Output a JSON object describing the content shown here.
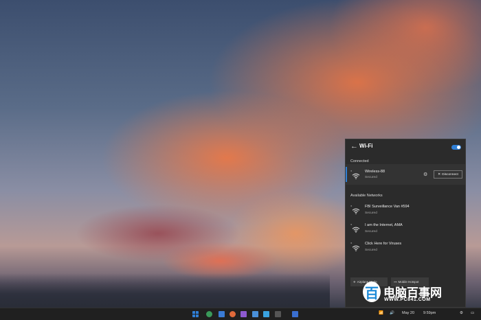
{
  "wifi_panel": {
    "title": "Wi-Fi",
    "back_icon": "←",
    "toggle_on": true,
    "connected_label": "Connected",
    "connected_network": {
      "name": "Wireless-88",
      "status": "Secured",
      "disconnect_label": "Disconnect"
    },
    "available_label": "Available Networks",
    "networks": [
      {
        "name": "FBI Surveillance Van #594",
        "status": "Secured"
      },
      {
        "name": "I am the Internet, AMA",
        "status": "Secured"
      },
      {
        "name": "Click Here for Viruses",
        "status": "Secured"
      }
    ],
    "bottom_buttons": [
      {
        "label": "Airplane Mode",
        "icon": "airplane-icon"
      },
      {
        "label": "Mobile Hotspot",
        "icon": "hotspot-icon"
      }
    ]
  },
  "taskbar": {
    "date": "May 20",
    "time": "9:59pm",
    "accent_color": "#2f7fd6"
  },
  "watermark": {
    "logo_letter": "百",
    "text": "电脑百事网",
    "url": "WWW.PC841.COM"
  }
}
